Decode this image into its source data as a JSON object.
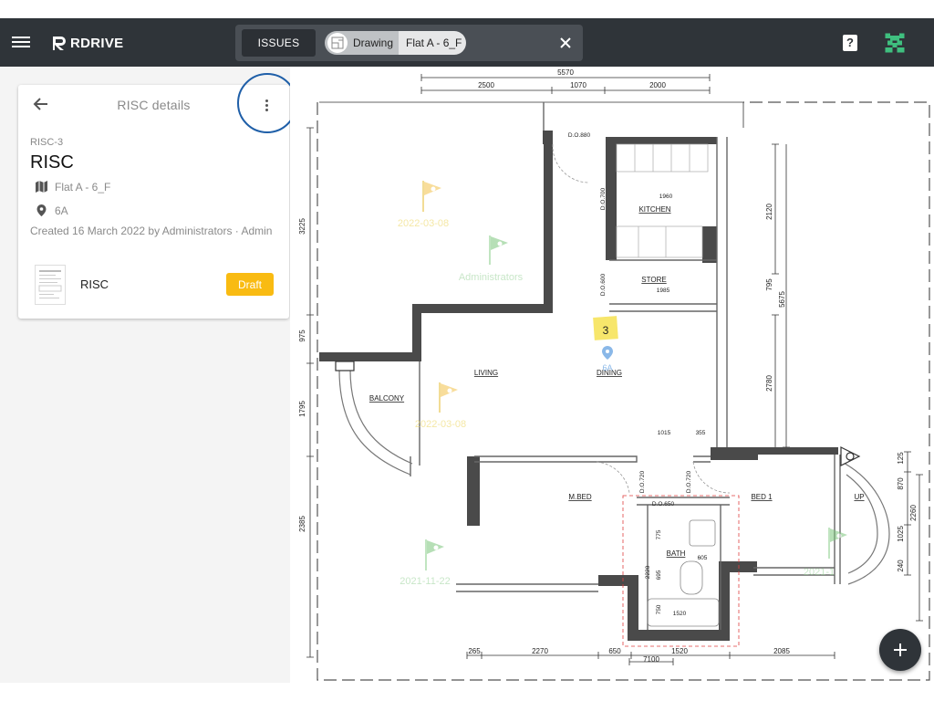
{
  "topbar": {
    "brand": "RDRIVE",
    "issues_label": "ISSUES",
    "chip_type": "Drawing",
    "chip_name": "Flat A - 6_F",
    "help_glyph": "?"
  },
  "panel": {
    "title": "RISC details",
    "risc_id": "RISC-3",
    "risc_name": "RISC",
    "drawing": "Flat A - 6_F",
    "location": "6A",
    "created": "Created 16 March 2022 by Administrators · Admin",
    "document_name": "RISC",
    "status": "Draft",
    "status_color": "#f9bb12"
  },
  "plan": {
    "dims_top": [
      "5570",
      "2500",
      "1070",
      "2000"
    ],
    "dims_bottom": [
      "265",
      "2270",
      "650",
      "1520",
      "2085",
      "7100"
    ],
    "dims_left": [
      "3225",
      "975",
      "1795",
      "2385"
    ],
    "dims_right": [
      "2120",
      "795",
      "5675",
      "2780",
      "125",
      "870",
      "2260",
      "1025",
      "240"
    ],
    "rooms": [
      "KITCHEN",
      "STORE",
      "LIVING",
      "DINING",
      "BALCONY",
      "M.BED",
      "BED 1",
      "BATH",
      "UP"
    ],
    "inner_dims": [
      "D.O.880",
      "D.O.700",
      "1960",
      "D.O.600",
      "1985",
      "1015",
      "355",
      "D.O.720",
      "D.O.720",
      "D.O.650",
      "775",
      "605",
      "2220",
      "695",
      "750",
      "1520"
    ],
    "pin_labels": [
      "2022-03-08",
      "Administrators",
      "2022-03-08",
      "2021-11-22",
      "2021-1"
    ],
    "marker_number": "3",
    "marker_location": "6A"
  },
  "colors": {
    "topbar": "#2f3439",
    "draft": "#f9bb12",
    "ring": "#1f5fa8",
    "marker": "#f7e66b"
  }
}
